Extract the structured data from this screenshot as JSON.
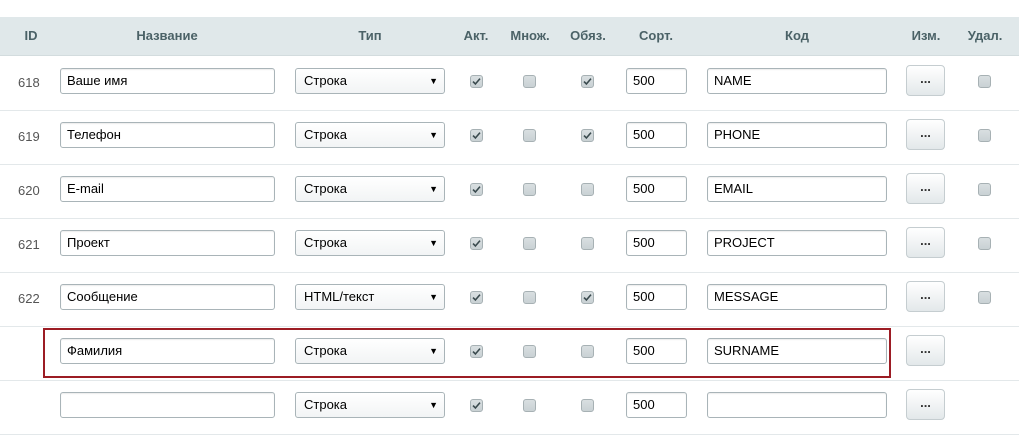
{
  "columns": {
    "id": "ID",
    "name": "Название",
    "type": "Тип",
    "active": "Акт.",
    "multiple": "Множ.",
    "required": "Обяз.",
    "sort": "Сорт.",
    "code": "Код",
    "edit": "Изм.",
    "delete": "Удал."
  },
  "rows": [
    {
      "id": "618",
      "name": "Ваше имя",
      "type": "Строка",
      "active": true,
      "multiple": false,
      "required": true,
      "sort": "500",
      "code": "NAME",
      "edit_label": "...",
      "has_delete": true
    },
    {
      "id": "619",
      "name": "Телефон",
      "type": "Строка",
      "active": true,
      "multiple": false,
      "required": true,
      "sort": "500",
      "code": "PHONE",
      "edit_label": "...",
      "has_delete": true
    },
    {
      "id": "620",
      "name": "E-mail",
      "type": "Строка",
      "active": true,
      "multiple": false,
      "required": false,
      "sort": "500",
      "code": "EMAIL",
      "edit_label": "...",
      "has_delete": true
    },
    {
      "id": "621",
      "name": "Проект",
      "type": "Строка",
      "active": true,
      "multiple": false,
      "required": false,
      "sort": "500",
      "code": "PROJECT",
      "edit_label": "...",
      "has_delete": true
    },
    {
      "id": "622",
      "name": "Сообщение",
      "type": "HTML/текст",
      "active": true,
      "multiple": false,
      "required": true,
      "sort": "500",
      "code": "MESSAGE",
      "edit_label": "...",
      "has_delete": true
    },
    {
      "id": "",
      "name": "Фамилия",
      "type": "Строка",
      "active": true,
      "multiple": false,
      "required": false,
      "sort": "500",
      "code": "SURNAME",
      "edit_label": "...",
      "has_delete": false
    },
    {
      "id": "",
      "name": "",
      "type": "Строка",
      "active": true,
      "multiple": false,
      "required": false,
      "sort": "500",
      "code": "",
      "edit_label": "...",
      "has_delete": false
    }
  ],
  "icons": {
    "dropdown": "triangle-down-icon",
    "check": "checkmark-icon"
  },
  "colors": {
    "header_bg": "#e0e8ea",
    "highlight_border": "#9c1c24"
  }
}
